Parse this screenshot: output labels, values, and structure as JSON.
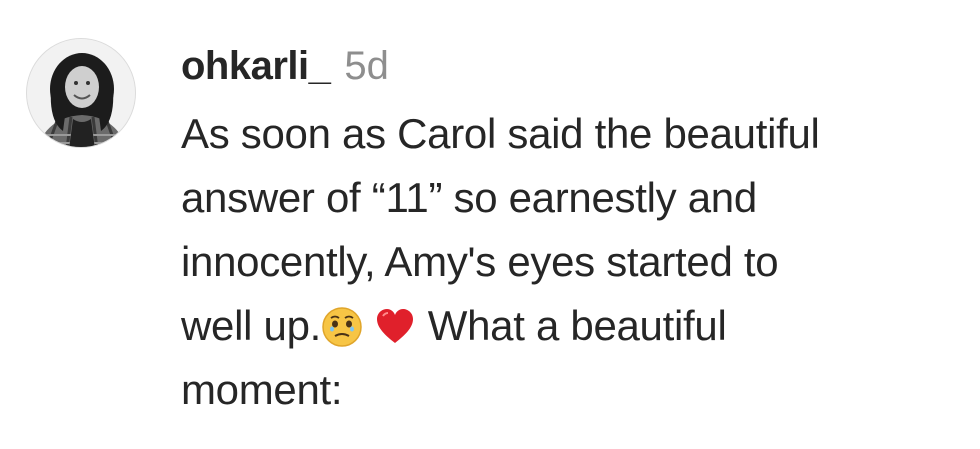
{
  "comment": {
    "avatar_icon": "profile-photo-avatar",
    "username": "ohkarli_",
    "timestamp": "5d",
    "text_part1": "As soon as Carol said the beautiful\nanswer of “11” so earnestly and\ninnocently, Amy's eyes started to\nwell up.",
    "emoji_1": "face-holding-back-tears-icon",
    "emoji_2": "red-heart-icon",
    "text_part2": " What a beautiful\nmoment:"
  },
  "colors": {
    "username": "#262626",
    "timestamp": "#8e8e8e",
    "text": "#262626",
    "heart": "#e0202b",
    "face": "#f7c545"
  }
}
